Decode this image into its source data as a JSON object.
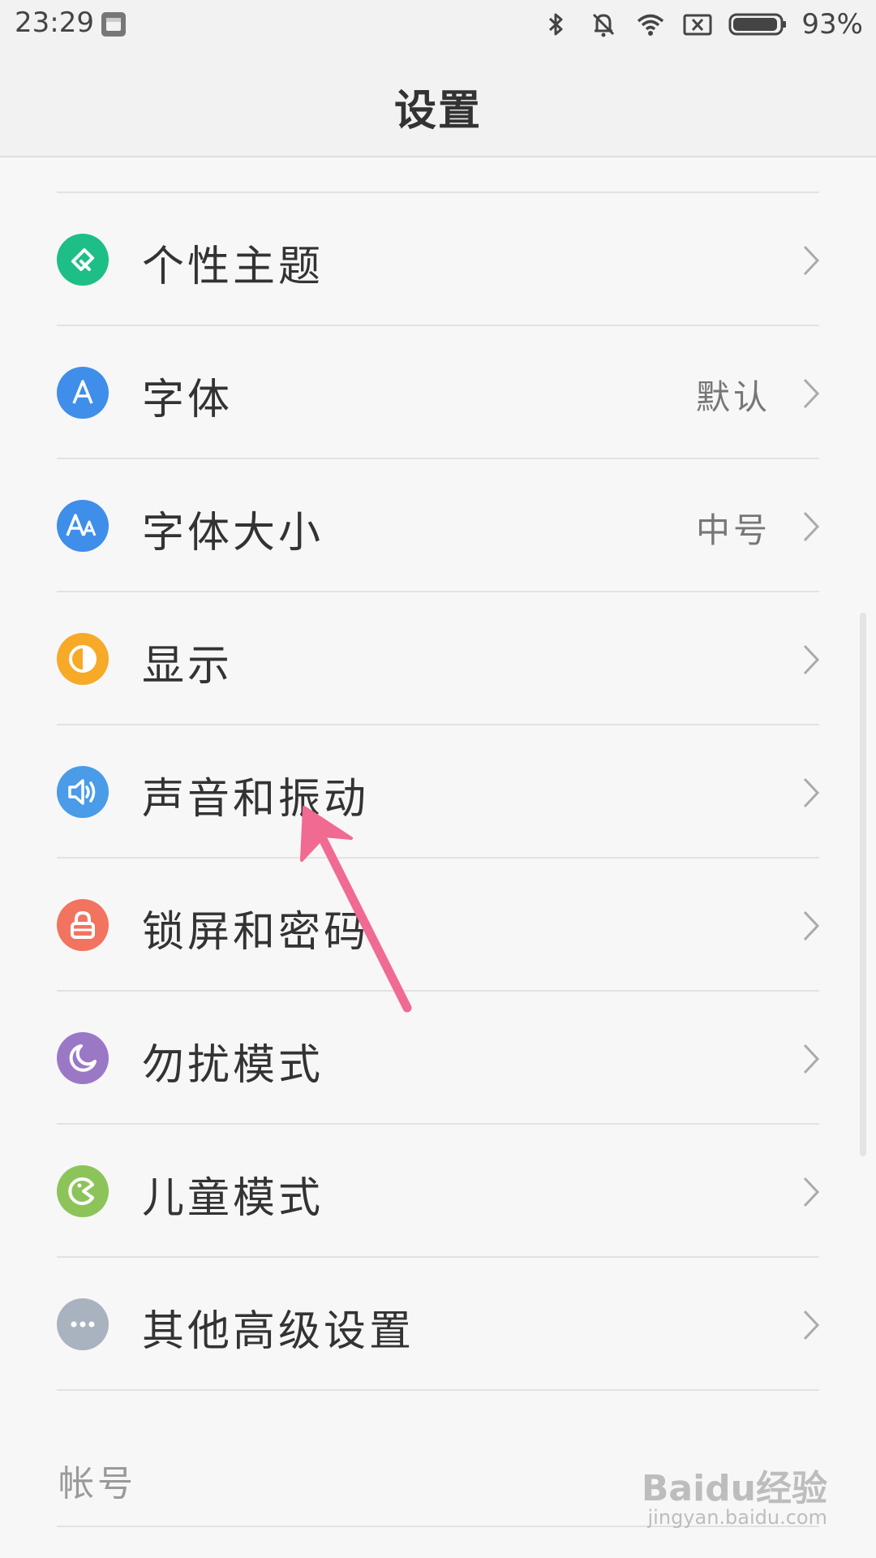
{
  "status_bar": {
    "time": "23:29",
    "battery_percent": "93%",
    "icons": [
      "app-notification-icon",
      "bluetooth-icon",
      "silent-bell-icon",
      "wifi-icon",
      "no-sim-icon",
      "battery-icon"
    ]
  },
  "header": {
    "title": "设置"
  },
  "settings_items": [
    {
      "label": "个性主题",
      "value": "",
      "icon": "theme-brush-icon",
      "color": "#1dbf87"
    },
    {
      "label": "字体",
      "value": "默认",
      "icon": "font-icon",
      "color": "#3f8ee9"
    },
    {
      "label": "字体大小",
      "value": "中号",
      "icon": "font-size-icon",
      "color": "#3f8ee9"
    },
    {
      "label": "显示",
      "value": "",
      "icon": "display-icon",
      "color": "#f7a928"
    },
    {
      "label": "声音和振动",
      "value": "",
      "icon": "speaker-icon",
      "color": "#4a9be8"
    },
    {
      "label": "锁屏和密码",
      "value": "",
      "icon": "lock-icon",
      "color": "#f2735f"
    },
    {
      "label": "勿扰模式",
      "value": "",
      "icon": "moon-icon",
      "color": "#9b78c6"
    },
    {
      "label": "儿童模式",
      "value": "",
      "icon": "kids-icon",
      "color": "#8cc45a"
    },
    {
      "label": "其他高级设置",
      "value": "",
      "icon": "more-icon",
      "color": "#a9b3bf"
    }
  ],
  "account_section": {
    "title": "帐号"
  },
  "annotation": {
    "color": "#f06a92"
  },
  "watermark": {
    "brand": "Baidu经验",
    "url": "jingyan.baidu.com"
  }
}
